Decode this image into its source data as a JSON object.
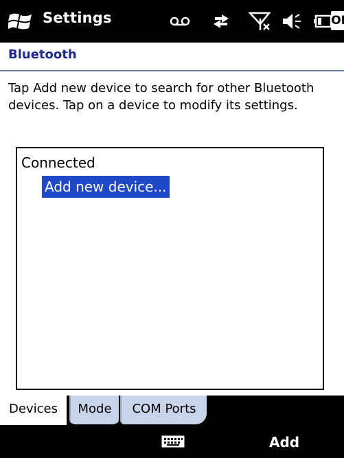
{
  "title_bar": {
    "title": "Settings",
    "ok_label": "OK",
    "icons": [
      "windows-flag-icon",
      "voicemail-icon",
      "data-connection-icon",
      "no-signal-icon",
      "speaker-icon",
      "battery-icon"
    ]
  },
  "header": {
    "title": "Bluetooth",
    "title_color": "#1b2a8c"
  },
  "instructions": "Tap Add new device to search for other Bluetooth devices. Tap on a device to modify its settings.",
  "device_list": {
    "group_label": "Connected",
    "items": [
      "Add new device..."
    ],
    "selected_index": 0,
    "selection_color": "#1f49c9"
  },
  "tabs": [
    {
      "label": "Devices",
      "active": true
    },
    {
      "label": "Mode",
      "active": false
    },
    {
      "label": "COM Ports",
      "active": false
    }
  ],
  "softkeys": {
    "right_label": "Add",
    "center_icon": "keyboard-icon"
  }
}
